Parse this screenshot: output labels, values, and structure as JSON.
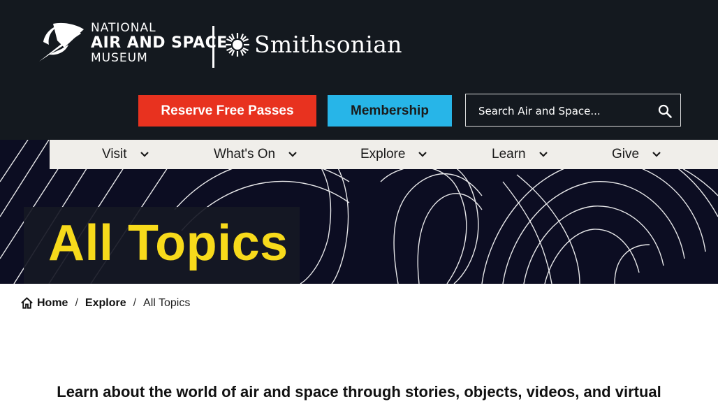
{
  "header": {
    "nasm_logo": {
      "line1": "NATIONAL",
      "line2": "AIR AND SPACE",
      "line3": "MUSEUM"
    },
    "smithsonian_logo": "Smithsonian",
    "reserve_button": "Reserve Free Passes",
    "membership_button": "Membership",
    "search": {
      "placeholder": "Search Air and Space..."
    }
  },
  "nav": {
    "items": [
      {
        "label": "Visit"
      },
      {
        "label": "What's On"
      },
      {
        "label": "Explore"
      },
      {
        "label": "Learn"
      },
      {
        "label": "Give"
      }
    ]
  },
  "hero": {
    "title": "All Topics"
  },
  "breadcrumb": {
    "home": "Home",
    "sep1": "/",
    "explore": "Explore",
    "sep2": "/",
    "current": "All Topics"
  },
  "intro": "Learn about the world of air and space through stories, objects, videos, and virtual",
  "colors": {
    "header_bg": "#14191f",
    "reserve_bg": "#e8321f",
    "membership_bg": "#27b5e8",
    "title_yellow": "#f7da1b",
    "nav_bg": "#f0eeea",
    "hero_bg": "#0c0d22"
  }
}
